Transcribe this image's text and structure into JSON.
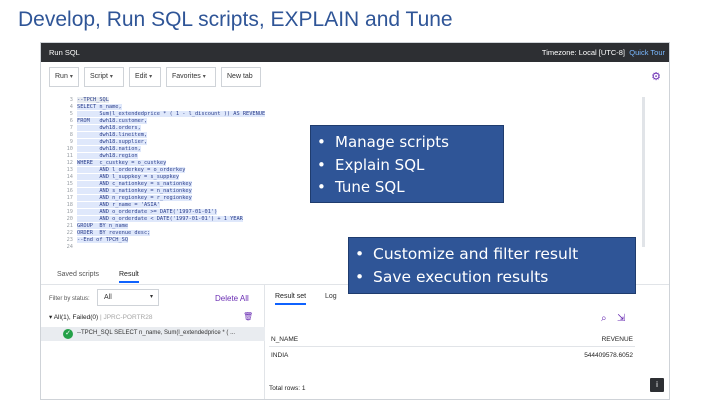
{
  "slide": {
    "title": "Develop, Run SQL scripts, EXPLAIN and Tune"
  },
  "app": {
    "name": "Run SQL",
    "timezone": "Timezone: Local [UTC-8]",
    "quick_tour": "Quick Tour",
    "toolbar": {
      "run": "Run",
      "script": "Script",
      "edit": "Edit",
      "favorites": "Favorites",
      "new_tab": "New tab"
    },
    "settings_icon": "gear-icon",
    "editor": {
      "lines": [
        {
          "n": "3",
          "code": "--TPCH_SQL"
        },
        {
          "n": "4",
          "code": "SELECT n_name,"
        },
        {
          "n": "5",
          "code": "       Sum(l_extendedprice * ( 1 - l_discount )) AS REVENUE"
        },
        {
          "n": "6",
          "code": "FROM   dwh18.customer,"
        },
        {
          "n": "7",
          "code": "       dwh18.orders,"
        },
        {
          "n": "8",
          "code": "       dwh18.lineitem,"
        },
        {
          "n": "9",
          "code": "       dwh18.supplier,"
        },
        {
          "n": "10",
          "code": "       dwh18.nation,"
        },
        {
          "n": "11",
          "code": "       dwh18.region"
        },
        {
          "n": "12",
          "code": "WHERE  c_custkey = o_custkey"
        },
        {
          "n": "13",
          "code": "       AND l_orderkey = o_orderkey"
        },
        {
          "n": "14",
          "code": "       AND l_suppkey = s_suppkey"
        },
        {
          "n": "15",
          "code": "       AND c_nationkey = s_nationkey"
        },
        {
          "n": "16",
          "code": "       AND s_nationkey = n_nationkey"
        },
        {
          "n": "17",
          "code": "       AND n_regionkey = r_regionkey"
        },
        {
          "n": "18",
          "code": "       AND r_name = 'ASIA'"
        },
        {
          "n": "19",
          "code": "       AND o_orderdate >= DATE('1997-01-01')"
        },
        {
          "n": "20",
          "code": "       AND o_orderdate < DATE('1997-01-01') + 1 YEAR"
        },
        {
          "n": "21",
          "code": "GROUP  BY n_name"
        },
        {
          "n": "22",
          "code": "ORDER  BY revenue desc;"
        },
        {
          "n": "23",
          "code": "--End of TPCH_SQ"
        },
        {
          "n": "24",
          "code": ""
        }
      ]
    },
    "bottom_tabs": {
      "saved_scripts": "Saved scripts",
      "result": "Result"
    },
    "left": {
      "filter_label": "Filter by status:",
      "filter_value": "All",
      "delete_all": "Delete All",
      "group_label": "All(1), Failed(0)",
      "group_id": "| JPRC-PORTR28",
      "script_item": "--TPCH_SQL SELECT n_name, Sum(l_extendedprice * ( ..."
    },
    "right": {
      "tab_result_set": "Result set",
      "tab_log": "Log",
      "search_icon": "search-icon",
      "export_icon": "export-icon",
      "columns": [
        "N_NAME",
        "REVENUE"
      ],
      "rows": [
        [
          "INDIA",
          "544409578.6052"
        ]
      ],
      "total_rows": "Total rows: 1"
    },
    "info_icon": "info-icon"
  },
  "callouts": {
    "one": [
      "Manage scripts",
      "Explain SQL",
      "Tune SQL"
    ],
    "two": [
      "Customize and filter result",
      "Save execution results"
    ]
  }
}
